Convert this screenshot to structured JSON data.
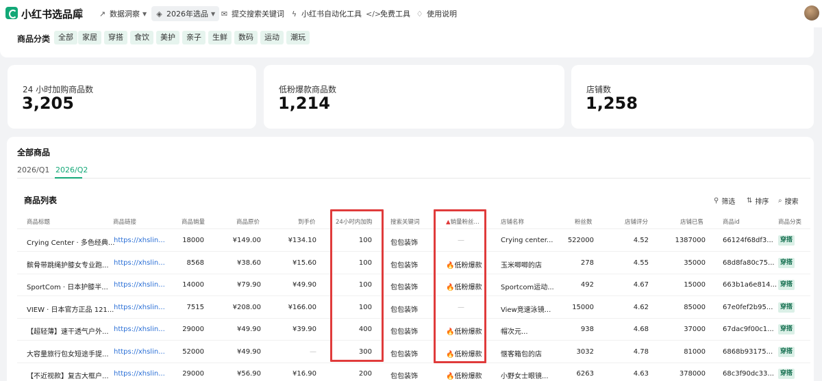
{
  "nav": {
    "app_title": "小红书选品库",
    "items": [
      {
        "label": "数据洞察",
        "icon": "trend-icon",
        "glyph": "↗",
        "has_caret": true,
        "active": false
      },
      {
        "label": "2026年选品",
        "icon": "layers-icon",
        "glyph": "◈",
        "has_caret": true,
        "active": true
      },
      {
        "label": "提交搜索关键词",
        "icon": "mail-icon",
        "glyph": "✉",
        "has_caret": false,
        "active": false
      },
      {
        "label": "小红书自动化工具",
        "icon": "lightning-icon",
        "glyph": "ϟ",
        "has_caret": false,
        "active": false
      },
      {
        "label": "免费工具",
        "icon": "code-icon",
        "glyph": "</>",
        "has_caret": false,
        "active": false
      },
      {
        "label": "使用说明",
        "icon": "lightbulb-icon",
        "glyph": "♢",
        "has_caret": false,
        "active": false
      }
    ]
  },
  "categories": {
    "label": "商品分类",
    "items": [
      "全部",
      "家居",
      "穿搭",
      "食饮",
      "美护",
      "亲子",
      "生鲜",
      "数码",
      "运动",
      "潮玩"
    ]
  },
  "stats": [
    {
      "label": "24 小时加购商品数",
      "value": "3,205"
    },
    {
      "label": "低粉爆款商品数",
      "value": "1,214"
    },
    {
      "label": "店铺数",
      "value": "1,258"
    }
  ],
  "products": {
    "section_title": "全部商品",
    "tabs": [
      {
        "label": "2026/Q1",
        "active": false
      },
      {
        "label": "2026/Q2",
        "active": true
      }
    ],
    "list_title": "商品列表",
    "tools": {
      "filter": "筛选",
      "sort": "排序",
      "search": "搜索"
    },
    "columns": [
      "商品标题",
      "商品链接",
      "商品销量",
      "商品原价",
      "到手价",
      "24小时内加购",
      "搜索关键词",
      "销量粉丝...",
      "店铺名称",
      "粉丝数",
      "店铺评分",
      "店铺已售",
      "商品id",
      "商品分类"
    ],
    "rows": [
      {
        "title": "Crying Center · 多色经典...",
        "link": "https://xhslin...",
        "sales": "18000",
        "orig_price": "¥149.00",
        "final_price": "¥134.10",
        "cart_24h": "100",
        "keyword": "包包装饰",
        "badge": "—",
        "shop": "Crying center...",
        "fans": "522000",
        "rating": "4.52",
        "shop_sold": "1387000",
        "id": "66124f68df3...",
        "category": "穿搭"
      },
      {
        "title": "髌骨带跳绳护膝女专业跑...",
        "link": "https://xhslin...",
        "sales": "8568",
        "orig_price": "¥38.60",
        "final_price": "¥15.60",
        "cart_24h": "100",
        "keyword": "包包装饰",
        "badge": "🔥低粉爆款",
        "shop": "玉米唧唧的店",
        "fans": "278",
        "rating": "4.55",
        "shop_sold": "35000",
        "id": "68d8fa80c75...",
        "category": "穿搭"
      },
      {
        "title": "SportCom · 日本护膝半...",
        "link": "https://xhslin...",
        "sales": "14000",
        "orig_price": "¥79.90",
        "final_price": "¥49.90",
        "cart_24h": "100",
        "keyword": "包包装饰",
        "badge": "🔥低粉爆款",
        "shop": "Sportcom运动...",
        "fans": "492",
        "rating": "4.67",
        "shop_sold": "15000",
        "id": "663b1a6e814...",
        "category": "穿搭"
      },
      {
        "title": "VIEW · 日本官方正品 121...",
        "link": "https://xhslin...",
        "sales": "7515",
        "orig_price": "¥208.00",
        "final_price": "¥166.00",
        "cart_24h": "100",
        "keyword": "包包装饰",
        "badge": "—",
        "shop": "View竞速泳镜...",
        "fans": "15000",
        "rating": "4.62",
        "shop_sold": "85000",
        "id": "67e0fef2b95...",
        "category": "穿搭"
      },
      {
        "title": "【超轻薄】速干透气户外...",
        "link": "https://xhslin...",
        "sales": "29000",
        "orig_price": "¥49.90",
        "final_price": "¥39.90",
        "cart_24h": "400",
        "keyword": "包包装饰",
        "badge": "🔥低粉爆款",
        "shop": "帽次元...",
        "fans": "938",
        "rating": "4.68",
        "shop_sold": "37000",
        "id": "67dac9f00c1...",
        "category": "穿搭"
      },
      {
        "title": "大容量旅行包女短途手提...",
        "link": "https://xhslin...",
        "sales": "52000",
        "orig_price": "¥49.90",
        "final_price": "—",
        "cart_24h": "300",
        "keyword": "包包装饰",
        "badge": "🔥低粉爆款",
        "shop": "惬客箱包的店",
        "fans": "3032",
        "rating": "4.78",
        "shop_sold": "81000",
        "id": "6868b93175...",
        "category": "穿搭"
      },
      {
        "title": "【不近视款】复古大框户...",
        "link": "https://xhslin...",
        "sales": "29000",
        "orig_price": "¥56.90",
        "final_price": "¥16.90",
        "cart_24h": "200",
        "keyword": "包包装饰",
        "badge": "🔥低粉爆款",
        "shop": "小野女士眼镜...",
        "fans": "6263",
        "rating": "4.63",
        "shop_sold": "378000",
        "id": "68c3f90dc33...",
        "category": "穿搭"
      }
    ]
  },
  "colors": {
    "accent": "#13a877",
    "link": "#2a6fd6",
    "highlight": "#e03b3b",
    "chip_bg": "#e6f4ee"
  }
}
